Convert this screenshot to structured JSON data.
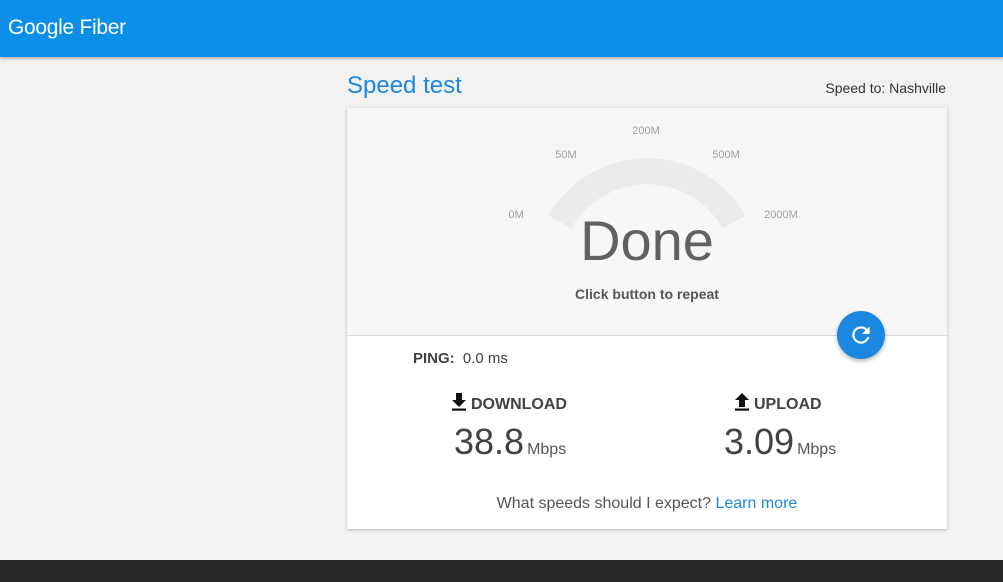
{
  "header": {
    "logo_text": "Google Fiber",
    "brand_color": "#0a8ee8"
  },
  "page": {
    "title": "Speed test",
    "speed_to": "Speed to: Nashville"
  },
  "gauge": {
    "ticks": [
      "0M",
      "50M",
      "200M",
      "500M",
      "2000M"
    ],
    "status": "Done",
    "hint": "Click button to repeat",
    "fill_fraction": 0
  },
  "repeat_button": {
    "icon": "refresh-icon"
  },
  "results": {
    "ping_label": "PING:",
    "ping_value": "0.0 ms",
    "download": {
      "icon": "download-icon",
      "label": "DOWNLOAD",
      "value": "38.8",
      "unit": "Mbps"
    },
    "upload": {
      "icon": "upload-icon",
      "label": "UPLOAD",
      "value": "3.09",
      "unit": "Mbps"
    }
  },
  "footer": {
    "question": "What speeds should I expect?",
    "link": "Learn more"
  }
}
